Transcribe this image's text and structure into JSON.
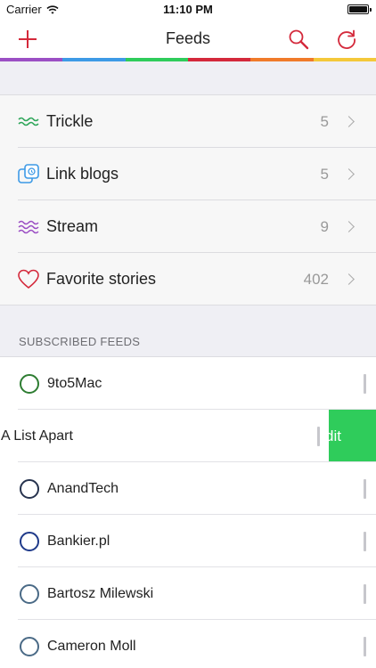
{
  "status_bar": {
    "carrier": "Carrier",
    "time": "11:10 PM"
  },
  "nav": {
    "title": "Feeds"
  },
  "colors": {
    "accent": "#d4293b",
    "rainbow": [
      "#9b4fc4",
      "#3d9ae6",
      "#2fcc5b",
      "#d4293b",
      "#f07a2a",
      "#f4c83a"
    ],
    "swipe_action": "#2fcc5b"
  },
  "top_rows": [
    {
      "label": "Trickle",
      "count": "5",
      "icon": "trickle-waves-icon"
    },
    {
      "label": "Link blogs",
      "count": "5",
      "icon": "link-blogs-icon"
    },
    {
      "label": "Stream",
      "count": "9",
      "icon": "stream-waves-icon"
    },
    {
      "label": "Favorite stories",
      "count": "402",
      "icon": "heart-icon"
    }
  ],
  "section": {
    "title": "SUBSCRIBED FEEDS"
  },
  "feeds": [
    {
      "label": "9to5Mac",
      "circle_color": "#2e7d32"
    },
    {
      "label": "A List Apart",
      "swipe_action_label": "dit"
    },
    {
      "label": "AnandTech",
      "circle_color": "#27334e"
    },
    {
      "label": "Bankier.pl",
      "circle_color": "#1f3a8a"
    },
    {
      "label": "Bartosz Milewski",
      "circle_color": "#4a6a86"
    },
    {
      "label": "Cameron Moll",
      "circle_color": "#4a6a86"
    }
  ]
}
